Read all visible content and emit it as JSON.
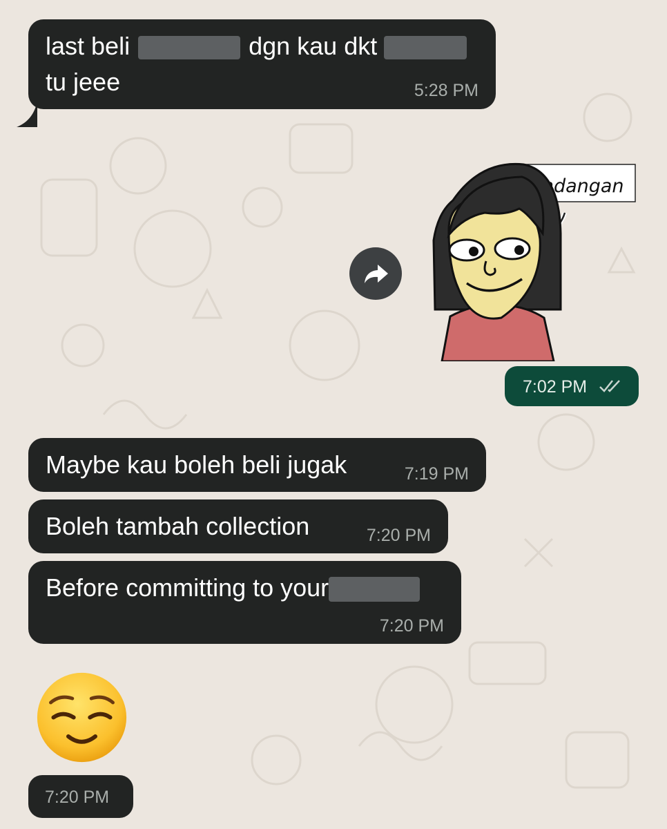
{
  "chat": {
    "messages": [
      {
        "direction": "incoming",
        "line1_a": "last beli",
        "line1_b": "dgn kau dkt",
        "line2": "tu jeee",
        "time": "5:28 PM"
      },
      {
        "direction": "outgoing",
        "type": "sticker",
        "sticker_caption": "Pandangan",
        "time": "7:02 PM",
        "status_icon": "double-check-icon"
      },
      {
        "direction": "incoming",
        "text": "Maybe kau boleh beli jugak",
        "time": "7:19 PM"
      },
      {
        "direction": "incoming",
        "text": "Boleh tambah collection",
        "time": "7:20 PM"
      },
      {
        "direction": "incoming",
        "text": "Before committing to your",
        "time": "7:20 PM"
      },
      {
        "direction": "incoming",
        "type": "emoji",
        "emoji_icon": "relieved-face-emoji",
        "time": "7:20 PM"
      }
    ]
  },
  "forward_button_icon": "forward-arrow-icon",
  "colors": {
    "incoming_bubble": "#222423",
    "outgoing_bubble": "#0d4b3a",
    "background": "#ece6df"
  }
}
